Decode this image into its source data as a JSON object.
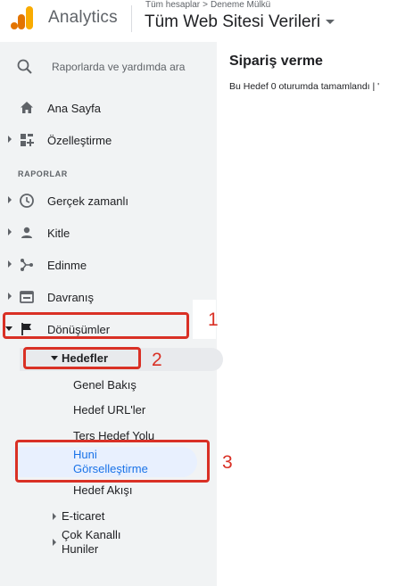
{
  "header": {
    "app_name": "Analytics",
    "breadcrumb": {
      "account": "Tüm hesaplar",
      "separator": ">",
      "property": "Deneme Mülkü"
    },
    "view_name": "Tüm Web Sitesi Verileri"
  },
  "sidebar": {
    "search_placeholder": "Raporlarda ve yardımda ara",
    "top_items": [
      {
        "label": "Ana Sayfa",
        "icon": "home-icon"
      },
      {
        "label": "Özelleştirme",
        "icon": "dashboard-grid-icon"
      }
    ],
    "section_label": "RAPORLAR",
    "report_items": [
      {
        "label": "Gerçek zamanlı",
        "icon": "clock-icon"
      },
      {
        "label": "Kitle",
        "icon": "person-icon"
      },
      {
        "label": "Edinme",
        "icon": "acquisition-icon"
      },
      {
        "label": "Davranış",
        "icon": "behavior-icon"
      },
      {
        "label": "Dönüşümler",
        "icon": "flag-icon"
      }
    ],
    "conversions_sub": {
      "goals_label": "Hedefler",
      "goals_children": [
        "Genel Bakış",
        "Hedef URL'ler",
        "Ters Hedef Yolu",
        "Huni Görselleştirme",
        "Hedef Akışı"
      ],
      "huni_line1": "Huni",
      "huni_line2": "Görselleştirme",
      "ecommerce_label": "E-ticaret",
      "multichannel_line1": "Çok Kanallı",
      "multichannel_line2": "Huniler"
    }
  },
  "annotations": {
    "n1": "1",
    "n2": "2",
    "n3": "3"
  },
  "content": {
    "title": "Sipariş verme",
    "subtitle": "Bu Hedef 0 oturumda tamamlandı | '"
  },
  "colors": {
    "sidebar_bg": "#f1f3f4",
    "annotation": "#d93025",
    "active_item_bg": "#e8f0fe",
    "active_item_text": "#1a73e8",
    "logo_orange": "#f9ab00",
    "logo_dark_orange": "#e37400"
  }
}
